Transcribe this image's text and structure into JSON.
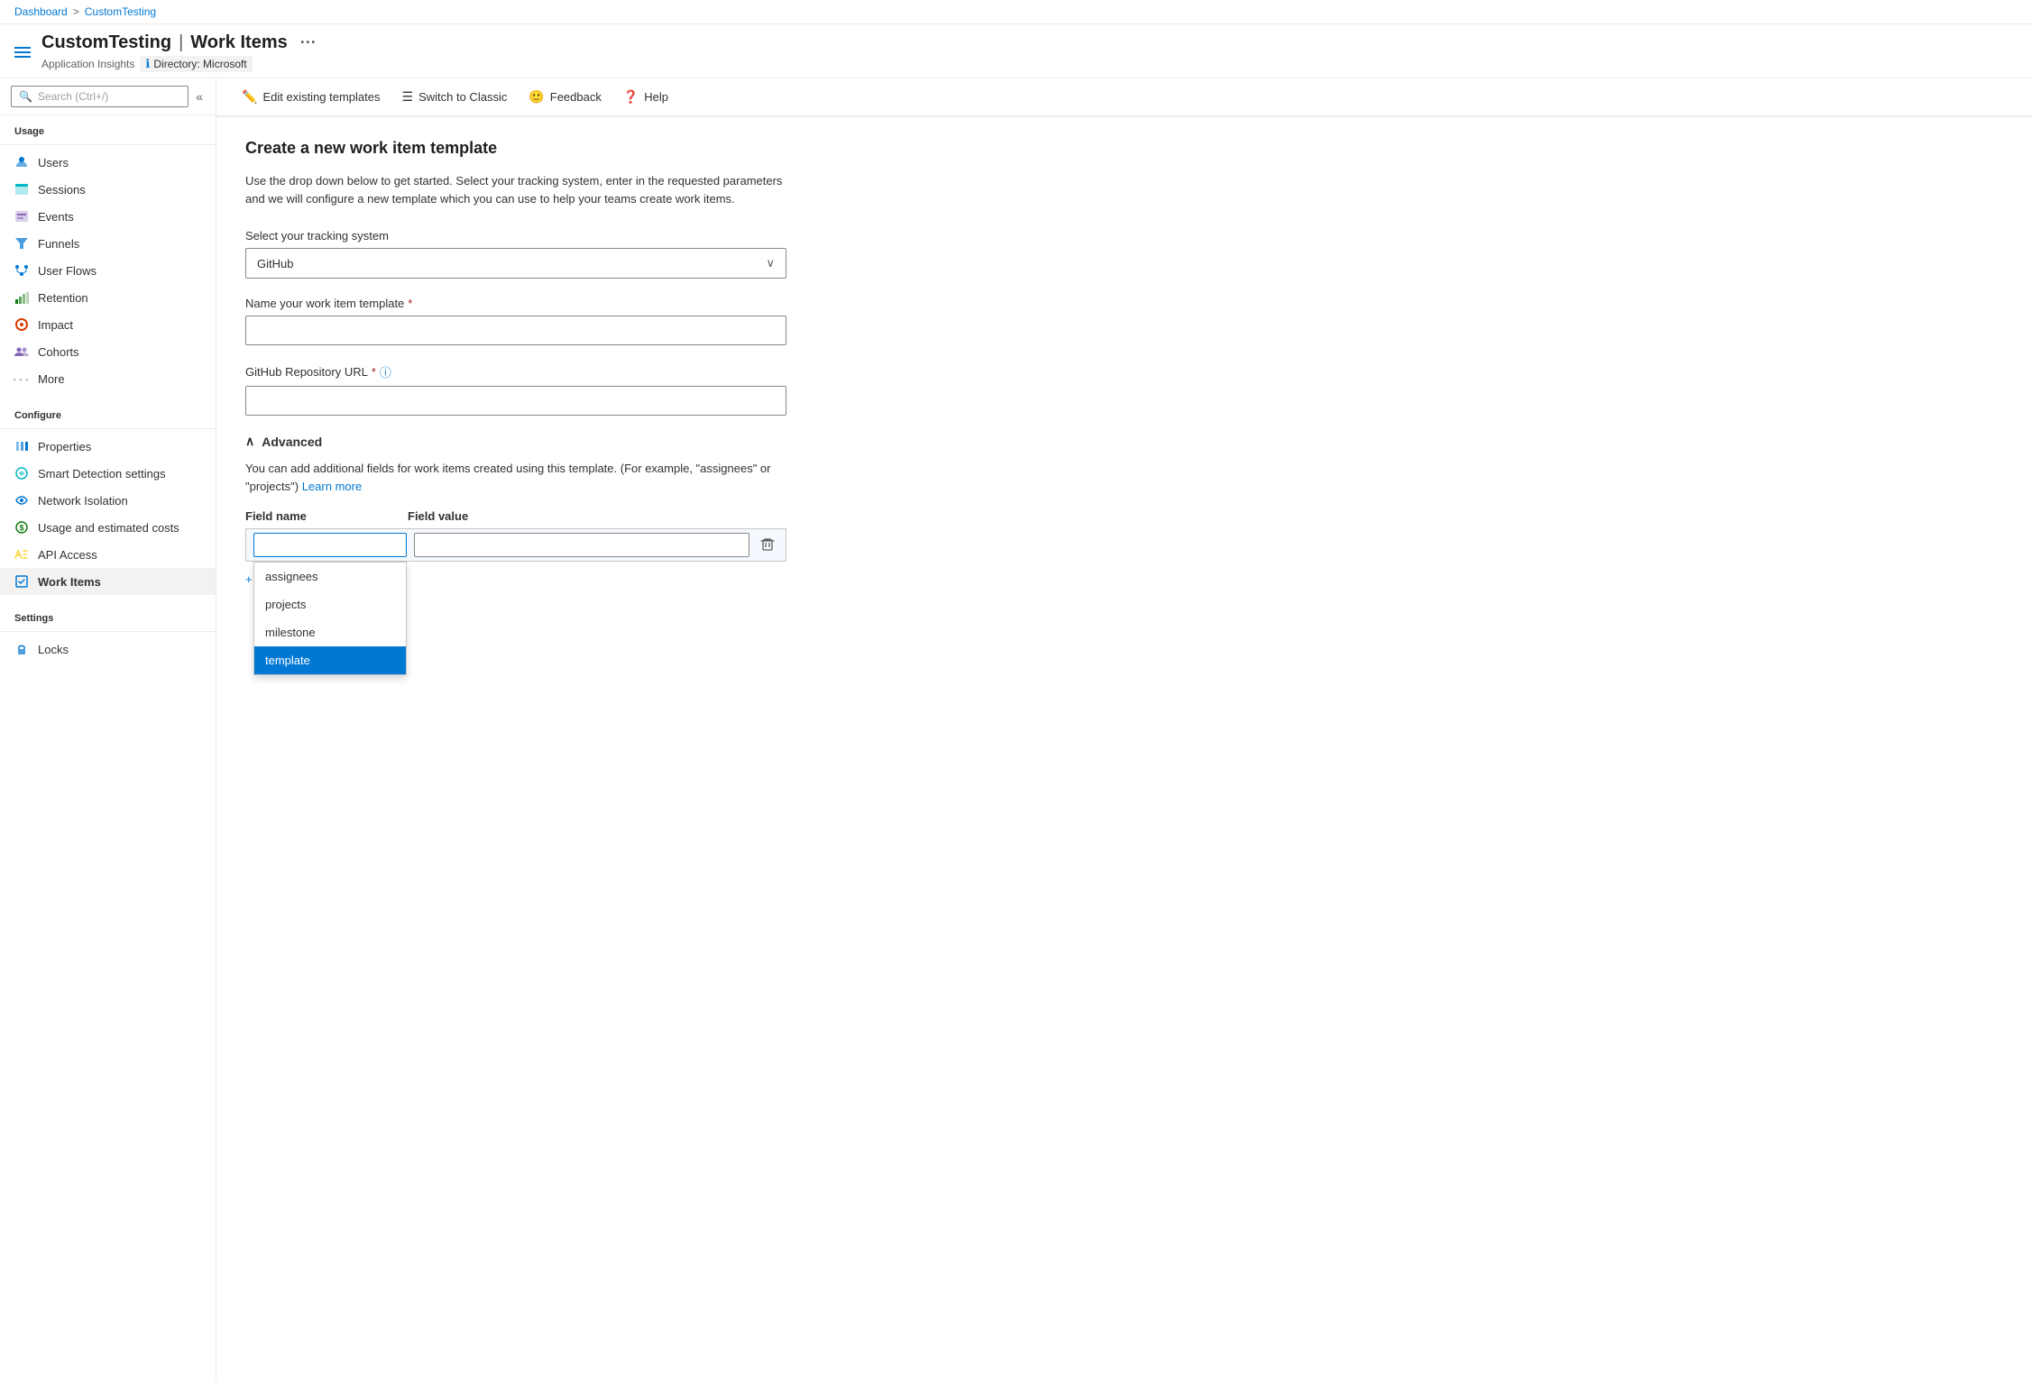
{
  "breadcrumb": {
    "dashboard": "Dashboard",
    "separator": ">",
    "current": "CustomTesting"
  },
  "page_title": {
    "app_name": "CustomTesting",
    "separator": "|",
    "section": "Work Items",
    "ellipsis": "···",
    "subtitle": "Application Insights",
    "directory_label": "Directory: Microsoft"
  },
  "sidebar": {
    "search_placeholder": "Search (Ctrl+/)",
    "usage_label": "Usage",
    "items_usage": [
      {
        "id": "users",
        "label": "Users",
        "icon": "user"
      },
      {
        "id": "sessions",
        "label": "Sessions",
        "icon": "sessions"
      },
      {
        "id": "events",
        "label": "Events",
        "icon": "events"
      },
      {
        "id": "funnels",
        "label": "Funnels",
        "icon": "funnels"
      },
      {
        "id": "user-flows",
        "label": "User Flows",
        "icon": "user-flows"
      },
      {
        "id": "retention",
        "label": "Retention",
        "icon": "retention"
      },
      {
        "id": "impact",
        "label": "Impact",
        "icon": "impact"
      },
      {
        "id": "cohorts",
        "label": "Cohorts",
        "icon": "cohorts"
      },
      {
        "id": "more",
        "label": "More",
        "icon": "ellipsis"
      }
    ],
    "configure_label": "Configure",
    "items_configure": [
      {
        "id": "properties",
        "label": "Properties",
        "icon": "properties"
      },
      {
        "id": "smart-detection",
        "label": "Smart Detection settings",
        "icon": "smart-detection"
      },
      {
        "id": "network-isolation",
        "label": "Network Isolation",
        "icon": "network-isolation"
      },
      {
        "id": "usage-costs",
        "label": "Usage and estimated costs",
        "icon": "usage-costs"
      },
      {
        "id": "api-access",
        "label": "API Access",
        "icon": "api-access"
      },
      {
        "id": "work-items",
        "label": "Work Items",
        "icon": "work-items",
        "active": true
      }
    ],
    "settings_label": "Settings",
    "items_settings": [
      {
        "id": "locks",
        "label": "Locks",
        "icon": "locks"
      }
    ]
  },
  "toolbar": {
    "edit_label": "Edit existing templates",
    "switch_label": "Switch to Classic",
    "feedback_label": "Feedback",
    "help_label": "Help"
  },
  "form": {
    "title": "Create a new work item template",
    "description": "Use the drop down below to get started. Select your tracking system, enter in the requested parameters and we will configure a new template which you can use to help your teams create work items.",
    "tracking_system_label": "Select your tracking system",
    "tracking_system_value": "GitHub",
    "template_name_label": "Name your work item template",
    "template_name_placeholder": "",
    "template_name_required": true,
    "github_url_label": "GitHub Repository URL",
    "github_url_placeholder": "",
    "github_url_required": true,
    "advanced_label": "Advanced",
    "advanced_description": "You can add additional fields for work items created using this template. (For example, \"assignees\" or \"projects\")",
    "learn_more_label": "Learn more",
    "field_name_header": "Field name",
    "field_value_header": "Field value",
    "field_name_placeholder": "",
    "field_value_placeholder": "",
    "suggestions": [
      {
        "id": "assignees",
        "label": "assignees"
      },
      {
        "id": "projects",
        "label": "projects"
      },
      {
        "id": "milestone",
        "label": "milestone"
      },
      {
        "id": "template",
        "label": "template",
        "selected": true
      }
    ],
    "add_row_label": "Add"
  }
}
